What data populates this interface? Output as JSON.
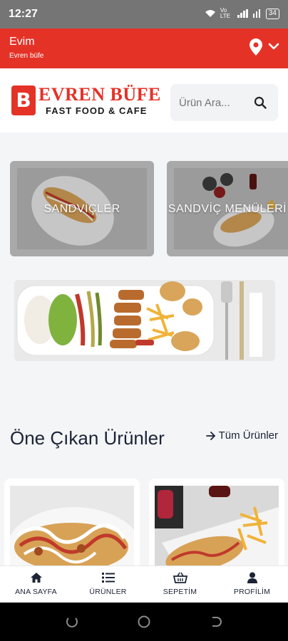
{
  "status": {
    "time": "12:27",
    "battery": "34",
    "network": "Vo LTE"
  },
  "address": {
    "title": "Evim",
    "subtitle": "Evren büfe"
  },
  "brand": {
    "name": "EVREN BÜFE",
    "tagline": "FAST FOOD & CAFE",
    "emblem": "B"
  },
  "search": {
    "placeholder": "Ürün Ara..."
  },
  "categories": [
    {
      "label": "SANDVİÇLER"
    },
    {
      "label": "SANDVİÇ MENÜLERİ"
    }
  ],
  "featured": {
    "title": "Öne Çıkan Ürünler",
    "link": "Tüm Ürünler"
  },
  "nav": [
    {
      "label": "ANA SAYFA",
      "icon": "home-icon"
    },
    {
      "label": "ÜRÜNLER",
      "icon": "list-icon"
    },
    {
      "label": "SEPETİM",
      "icon": "basket-icon"
    },
    {
      "label": "PROFİLİM",
      "icon": "user-icon"
    }
  ],
  "colors": {
    "brand_red": "#e53227",
    "text_dark": "#1b2336"
  }
}
